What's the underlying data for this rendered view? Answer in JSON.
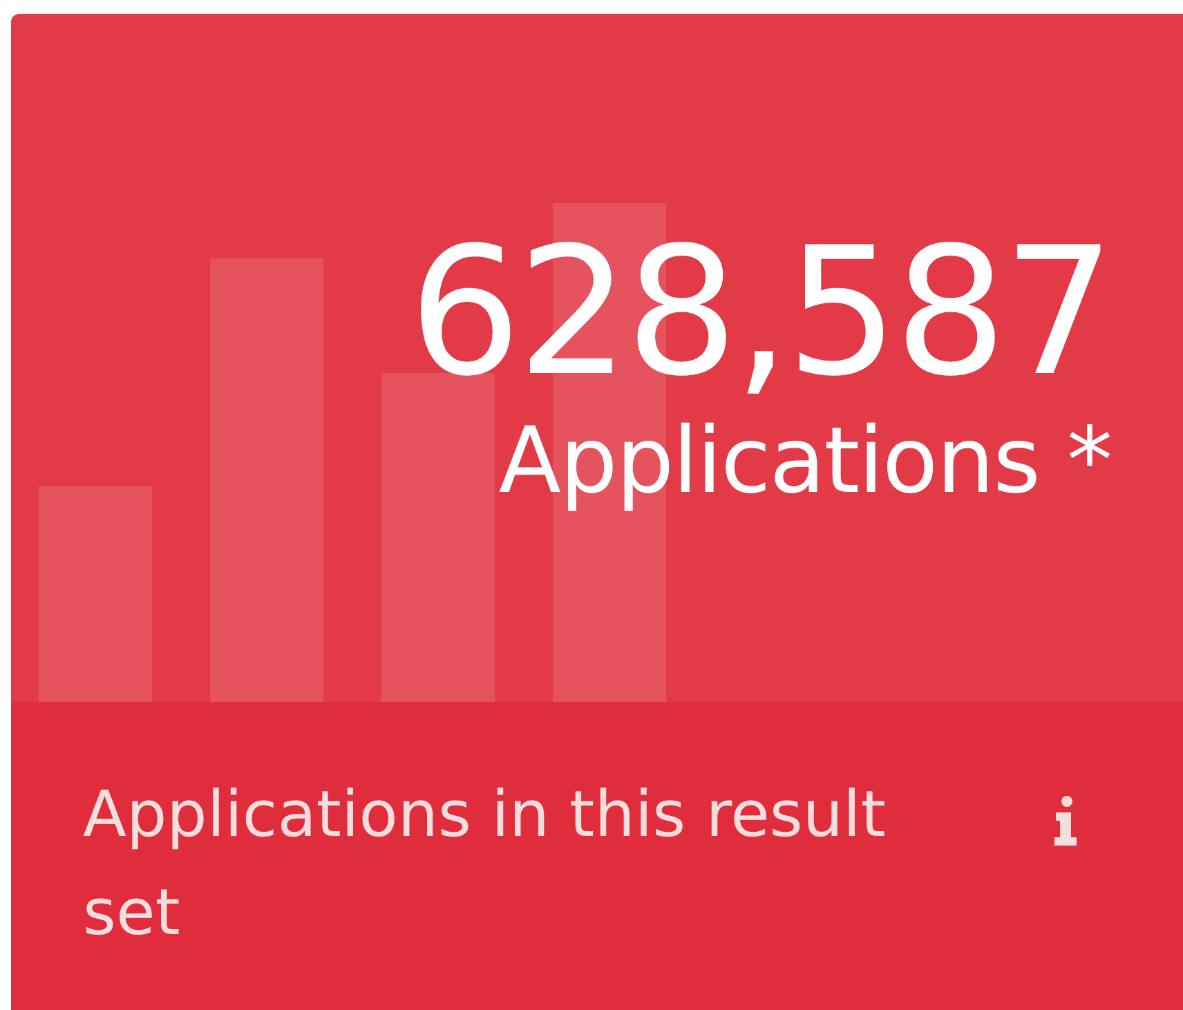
{
  "stat_card": {
    "value": "628,587",
    "label": "Applications *",
    "description": "Applications in this result set"
  }
}
